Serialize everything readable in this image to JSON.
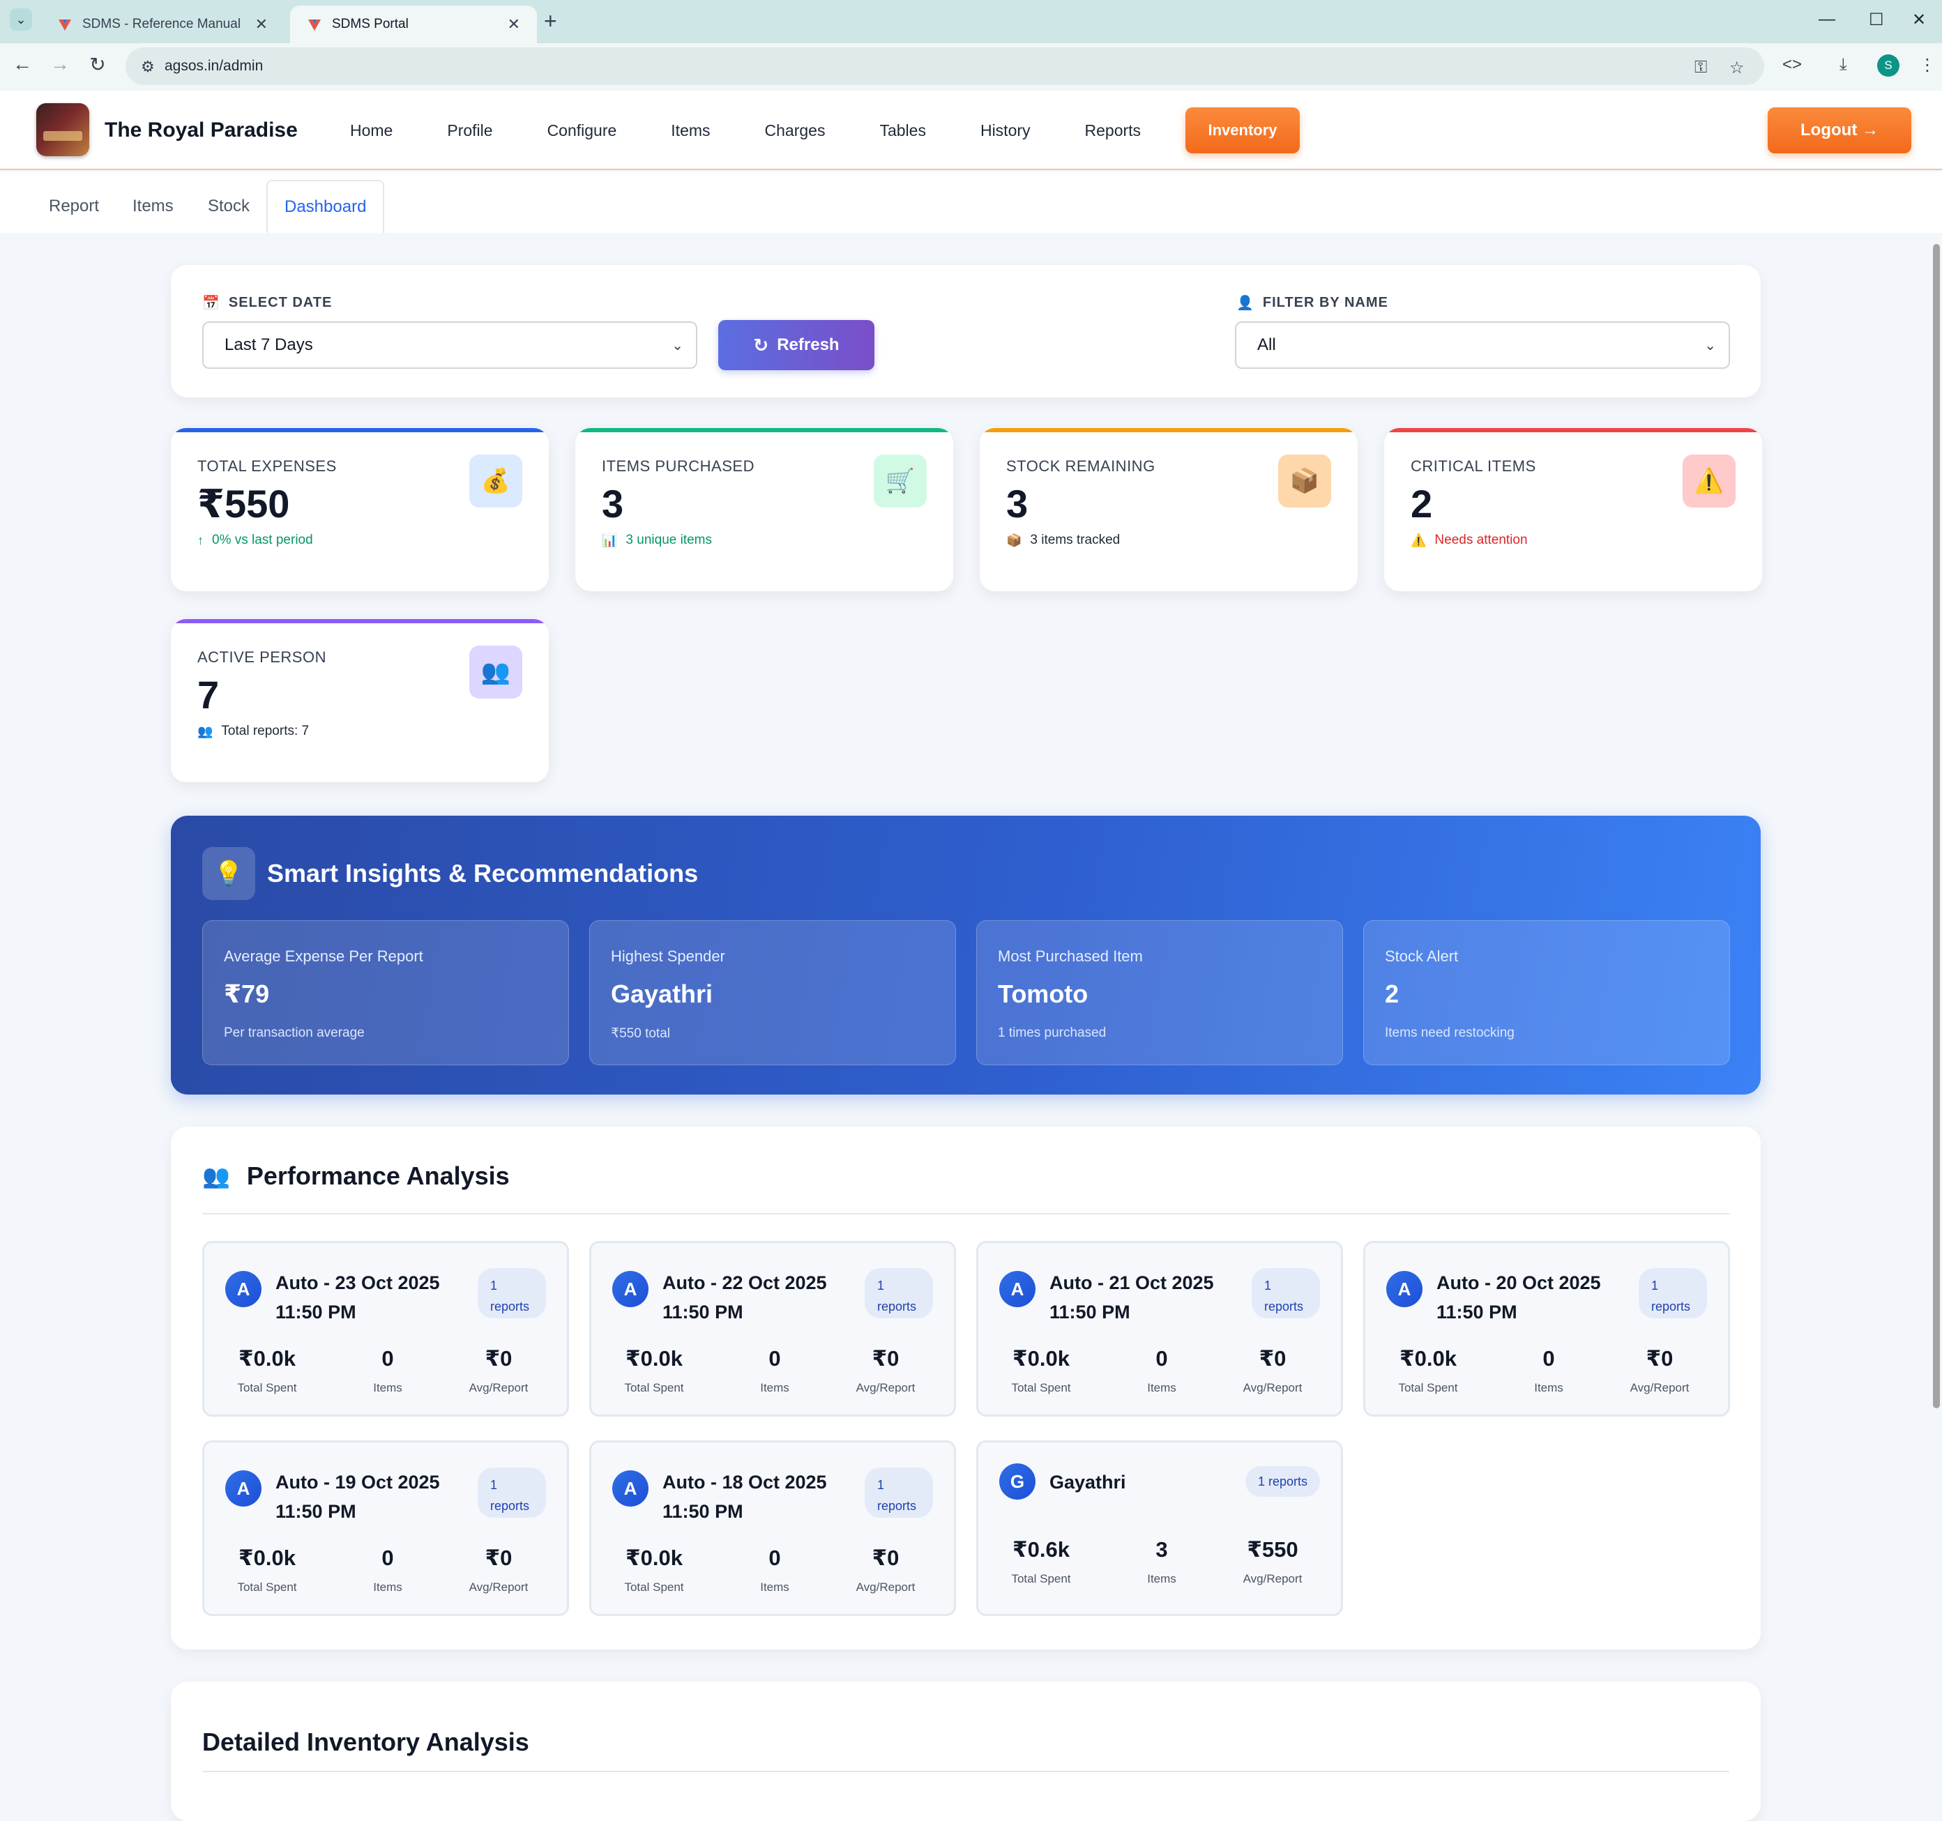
{
  "browser": {
    "tabs": [
      {
        "title": "SDMS - Reference Manual",
        "active": false
      },
      {
        "title": "SDMS Portal",
        "active": true
      }
    ],
    "url": "agsos.in/admin",
    "profile_initial": "S"
  },
  "header": {
    "brand": "The Royal Paradise",
    "nav": [
      "Home",
      "Profile",
      "Configure",
      "Items",
      "Charges",
      "Tables",
      "History",
      "Reports"
    ],
    "inventory_label": "Inventory",
    "logout_label": "Logout →"
  },
  "subtabs": [
    "Report",
    "Items",
    "Stock",
    "Dashboard"
  ],
  "filters": {
    "date_label": "SELECT DATE",
    "date_value": "Last 7 Days",
    "refresh_label": "Refresh",
    "name_label": "FILTER BY NAME",
    "name_value": "All"
  },
  "stats": [
    {
      "label": "TOTAL EXPENSES",
      "value": "₹550",
      "sub_icon": "↑",
      "sub": "0%  vs last period",
      "icon": "💰",
      "accent": "#2563eb",
      "sub_color": "#059669",
      "icon_bg": "#dbeafe"
    },
    {
      "label": "ITEMS PURCHASED",
      "value": "3",
      "sub_icon": "📊",
      "sub": "3 unique items",
      "icon": "🛒",
      "accent": "#10b981",
      "sub_color": "#059669",
      "icon_bg": "#d1fae5"
    },
    {
      "label": "STOCK REMAINING",
      "value": "3",
      "sub_icon": "📦",
      "sub": "3 items tracked",
      "icon": "📦",
      "accent": "#f59e0b",
      "sub_color": "#1f2937",
      "icon_bg": "#fed7aa"
    },
    {
      "label": "CRITICAL ITEMS",
      "value": "2",
      "sub_icon": "⚠️",
      "sub": "Needs attention",
      "icon": "⚠️",
      "accent": "#ef4444",
      "sub_color": "#dc2626",
      "icon_bg": "#fecaca"
    },
    {
      "label": "ACTIVE PERSON",
      "value": "7",
      "sub_icon": "👥",
      "sub": "Total reports: 7",
      "icon": "👥",
      "accent": "#8b5cf6",
      "sub_color": "#1f2937",
      "icon_bg": "#ddd6fe"
    }
  ],
  "insights": {
    "title": "Smart Insights & Recommendations",
    "icon": "💡",
    "cards": [
      {
        "label": "Average Expense Per Report",
        "value": "₹79",
        "sub": "Per transaction average"
      },
      {
        "label": "Highest Spender",
        "value": "Gayathri",
        "sub": "₹550 total"
      },
      {
        "label": "Most Purchased Item",
        "value": "Tomoto",
        "sub": "1 times purchased"
      },
      {
        "label": "Stock Alert",
        "value": "2",
        "sub": "Items need restocking"
      }
    ]
  },
  "performance": {
    "title": "Performance Analysis",
    "people": [
      {
        "initial": "A",
        "name": "Auto - 23 Oct 2025 11:50 PM",
        "badge_count": "1",
        "badge_unit": "reports",
        "spent": "₹0.0k",
        "items": "0",
        "avg": "₹0"
      },
      {
        "initial": "A",
        "name": "Auto - 22 Oct 2025 11:50 PM",
        "badge_count": "1",
        "badge_unit": "reports",
        "spent": "₹0.0k",
        "items": "0",
        "avg": "₹0"
      },
      {
        "initial": "A",
        "name": "Auto - 21 Oct 2025 11:50 PM",
        "badge_count": "1",
        "badge_unit": "reports",
        "spent": "₹0.0k",
        "items": "0",
        "avg": "₹0"
      },
      {
        "initial": "A",
        "name": "Auto - 20 Oct 2025 11:50 PM",
        "badge_count": "1",
        "badge_unit": "reports",
        "spent": "₹0.0k",
        "items": "0",
        "avg": "₹0"
      },
      {
        "initial": "A",
        "name": "Auto - 19 Oct 2025 11:50 PM",
        "badge_count": "1",
        "badge_unit": "reports",
        "spent": "₹0.0k",
        "items": "0",
        "avg": "₹0"
      },
      {
        "initial": "A",
        "name": "Auto - 18 Oct 2025 11:50 PM",
        "badge_count": "1",
        "badge_unit": "reports",
        "spent": "₹0.0k",
        "items": "0",
        "avg": "₹0"
      },
      {
        "initial": "G",
        "name": "Gayathri",
        "badge_count": "1",
        "badge_unit": "reports",
        "spent": "₹0.6k",
        "items": "3",
        "avg": "₹550"
      }
    ],
    "metric_labels": {
      "spent": "Total Spent",
      "items": "Items",
      "avg": "Avg/Report"
    }
  },
  "detail": {
    "title": "Detailed Inventory Analysis"
  }
}
